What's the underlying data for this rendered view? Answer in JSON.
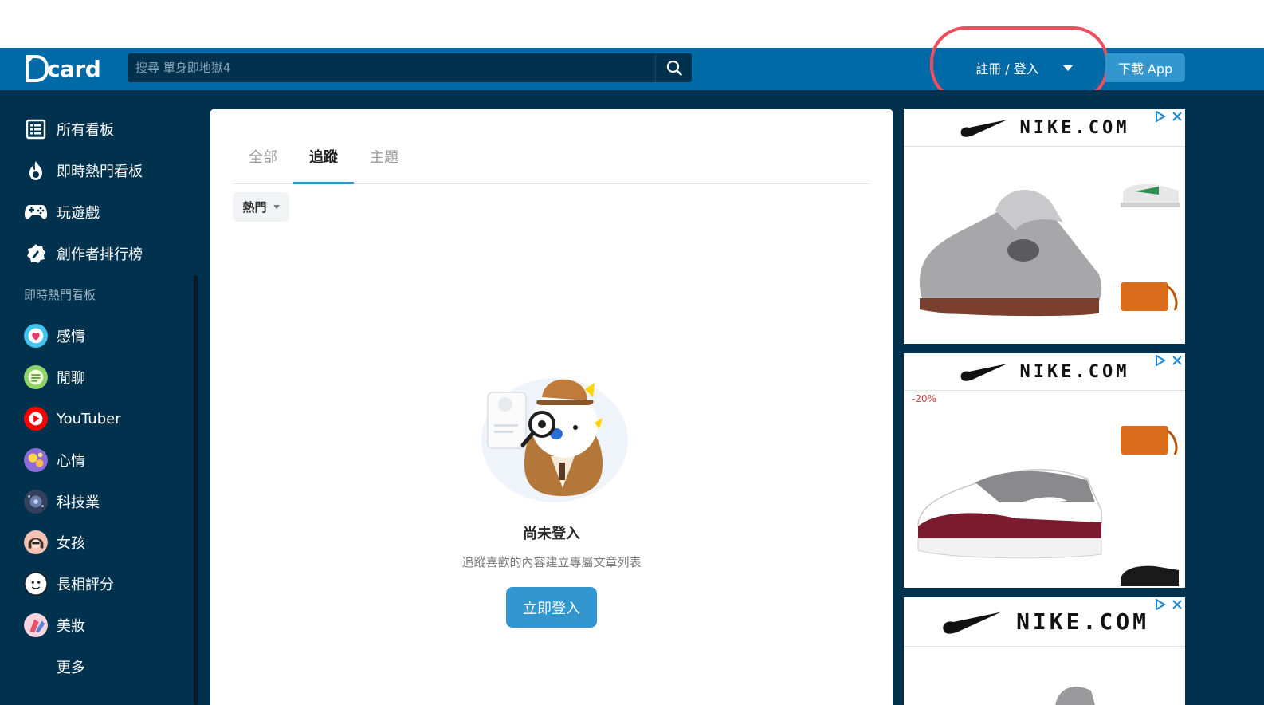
{
  "header": {
    "logo_text": "card",
    "search_placeholder": "搜尋 單身即地獄4",
    "login_label": "註冊 / 登入",
    "download_label": "下載 App"
  },
  "sidebar": {
    "items": [
      {
        "label": "所有看板",
        "icon": "list-icon"
      },
      {
        "label": "即時熱門看板",
        "icon": "flame-icon"
      },
      {
        "label": "玩遊戲",
        "icon": "gamepad-icon"
      },
      {
        "label": "創作者排行榜",
        "icon": "pen-badge-icon"
      }
    ],
    "section_label": "即時熱門看板",
    "boards": [
      {
        "label": "感情",
        "color": "#42c3f0"
      },
      {
        "label": "閒聊",
        "color": "#8fd36b"
      },
      {
        "label": "YouTuber",
        "color": "#ff0000"
      },
      {
        "label": "心情",
        "color": "#8e6cd8"
      },
      {
        "label": "科技業",
        "color": "#33405c"
      },
      {
        "label": "女孩",
        "color": "#f4c2b3"
      },
      {
        "label": "長相評分",
        "color": "#ffffff"
      },
      {
        "label": "美妝",
        "color": "#f4a0b8"
      }
    ],
    "more_label": "更多"
  },
  "content": {
    "tabs": [
      {
        "label": "全部",
        "active": false
      },
      {
        "label": "追蹤",
        "active": true
      },
      {
        "label": "主題",
        "active": false
      }
    ],
    "sort_label": "熱門",
    "empty_title": "尚未登入",
    "empty_desc": "追蹤喜歡的內容建立專屬文章列表",
    "login_button": "立即登入"
  },
  "ads": {
    "brand": "NIKE.COM",
    "discount": "-20%"
  },
  "colors": {
    "header_blue": "#006aa6",
    "dark_navy": "#00324e",
    "accent": "#3397cf",
    "highlight": "#ef4e5e"
  }
}
